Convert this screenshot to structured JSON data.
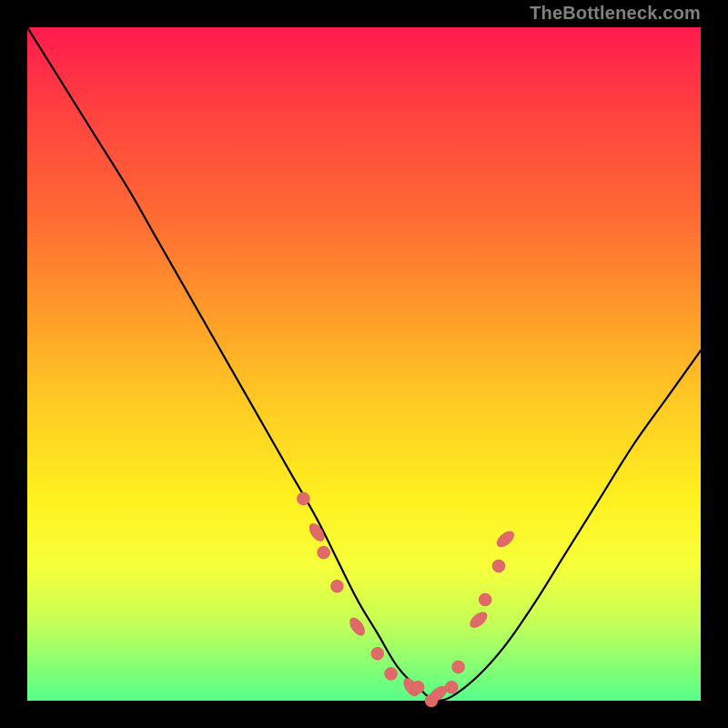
{
  "watermark": "TheBottleneck.com",
  "chart_data": {
    "type": "line",
    "title": "",
    "xlabel": "",
    "ylabel": "",
    "xlim": [
      0,
      100
    ],
    "ylim": [
      0,
      100
    ],
    "grid": false,
    "series": [
      {
        "name": "bottleneck-curve",
        "x": [
          0,
          5,
          10,
          15,
          19,
          23,
          27,
          31,
          35,
          39,
          43,
          46,
          49,
          52,
          55,
          58,
          61,
          65,
          70,
          75,
          80,
          85,
          90,
          95,
          100
        ],
        "values": [
          100,
          92,
          84,
          76,
          69,
          62,
          55,
          48,
          41,
          34,
          27,
          21,
          15,
          10,
          5,
          2,
          0,
          2,
          7,
          14,
          22,
          30,
          38,
          45,
          52
        ]
      }
    ],
    "marker_points": {
      "name": "highlight-dots",
      "x": [
        41,
        43,
        44,
        46,
        49,
        52,
        54,
        57,
        58,
        60,
        61,
        63,
        64,
        67,
        68,
        70,
        71
      ],
      "values": [
        30,
        25,
        22,
        17,
        11,
        7,
        4,
        2,
        2,
        0,
        1,
        2,
        5,
        12,
        15,
        20,
        24
      ]
    }
  }
}
